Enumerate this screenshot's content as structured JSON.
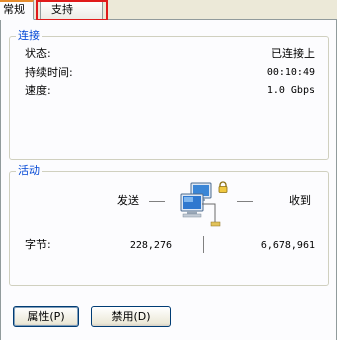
{
  "tabs": [
    {
      "label": "常规",
      "active": true
    },
    {
      "label": "支持",
      "active": false
    }
  ],
  "connection": {
    "title": "连接",
    "rows": [
      {
        "label": "状态:",
        "value": "已连接上"
      },
      {
        "label": "持续时间:",
        "value": "00:10:49"
      },
      {
        "label": "速度:",
        "value": "1.0 Gbps"
      }
    ]
  },
  "activity": {
    "title": "活动",
    "sent_label": "发送",
    "received_label": "收到",
    "bytes_label": "字节:",
    "bytes_sent": "228,276",
    "bytes_received": "6,678,961"
  },
  "buttons": {
    "properties": "属性(P)",
    "disable": "禁用(D)"
  },
  "icons": {
    "network": "network-computers-icon",
    "lock": "lock-icon"
  },
  "colors": {
    "group_title": "#0046d5",
    "highlight_box": "#e01b1b"
  }
}
